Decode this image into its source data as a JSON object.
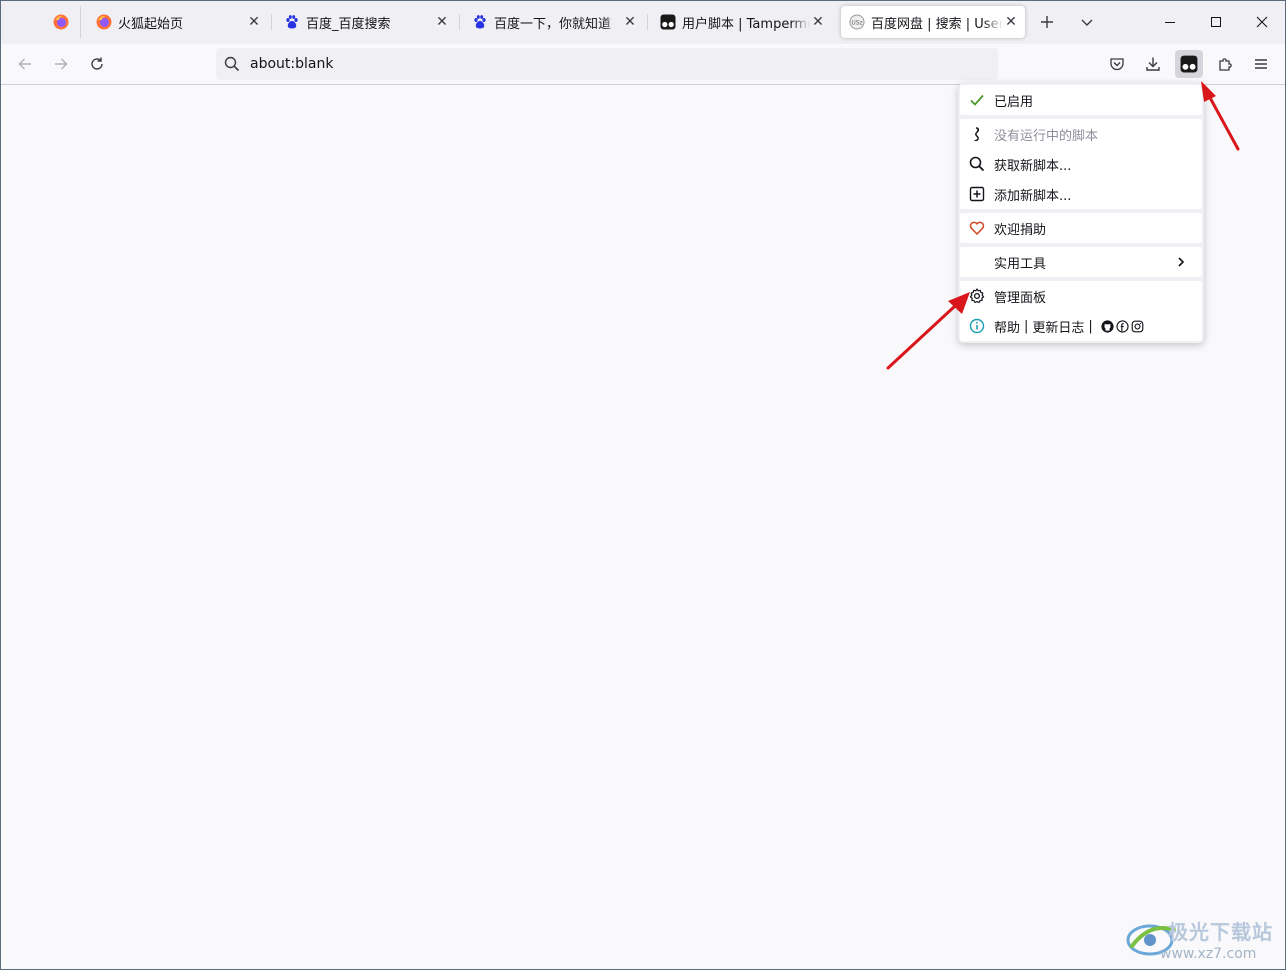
{
  "browser": {
    "tabs": [
      {
        "title": "火狐起始页",
        "favicon": "firefox-icon",
        "active": false
      },
      {
        "title": "百度_百度搜索",
        "favicon": "baidu-paw-icon",
        "active": false
      },
      {
        "title": "百度一下，你就知道",
        "favicon": "baidu-paw-icon",
        "active": false
      },
      {
        "title": "用户脚本 | Tampermonkey",
        "favicon": "tampermonkey-icon",
        "active": false
      },
      {
        "title": "百度网盘 | 搜索 | Userscripts",
        "favicon": "userscript-icon",
        "active": true
      }
    ],
    "url": "about:blank"
  },
  "tampermonkey_menu": {
    "enabled_label": "已启用",
    "no_scripts_label": "没有运行中的脚本",
    "get_new_label": "获取新脚本...",
    "add_new_label": "添加新脚本...",
    "donate_label": "欢迎捐助",
    "utilities_label": "实用工具",
    "dashboard_label": "管理面板",
    "help_label": "帮助",
    "changelog_label": "更新日志",
    "separator": "|"
  },
  "watermark": {
    "line1": "极光下载站",
    "line2": "www.xz7.com"
  },
  "colors": {
    "check_green": "#4c9a2a",
    "heart_red": "#d24726",
    "info_teal": "#1a9fb4",
    "arrow_red": "#d8161b",
    "baidu_blue": "#2932e1"
  }
}
